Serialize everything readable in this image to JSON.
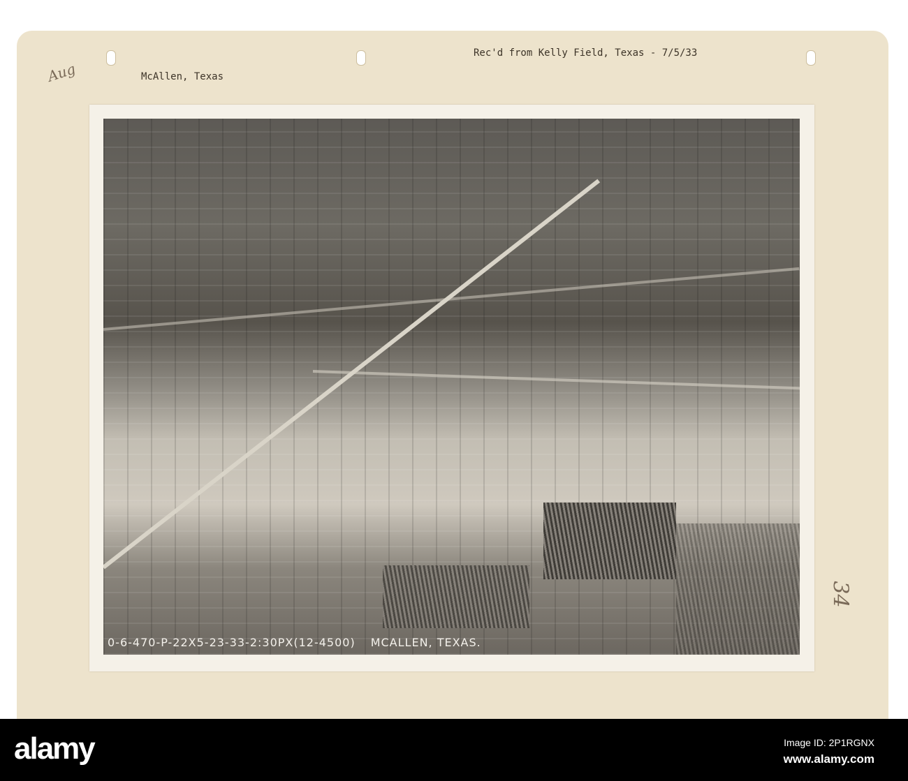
{
  "card": {
    "location_label": "McAllen, Texas",
    "received_note": "Rec'd from Kelly Field, Texas - 7/5/33",
    "handwritten_top": "Aug",
    "handwritten_number": "34"
  },
  "photo": {
    "caption_code": "0-6-470-P-22X5-23-33-2:30PX(12-4500)",
    "caption_place": "MCALLEN, TEXAS."
  },
  "footer": {
    "logo": "alamy",
    "image_id": "Image ID: 2P1RGNX",
    "url": "www.alamy.com"
  }
}
